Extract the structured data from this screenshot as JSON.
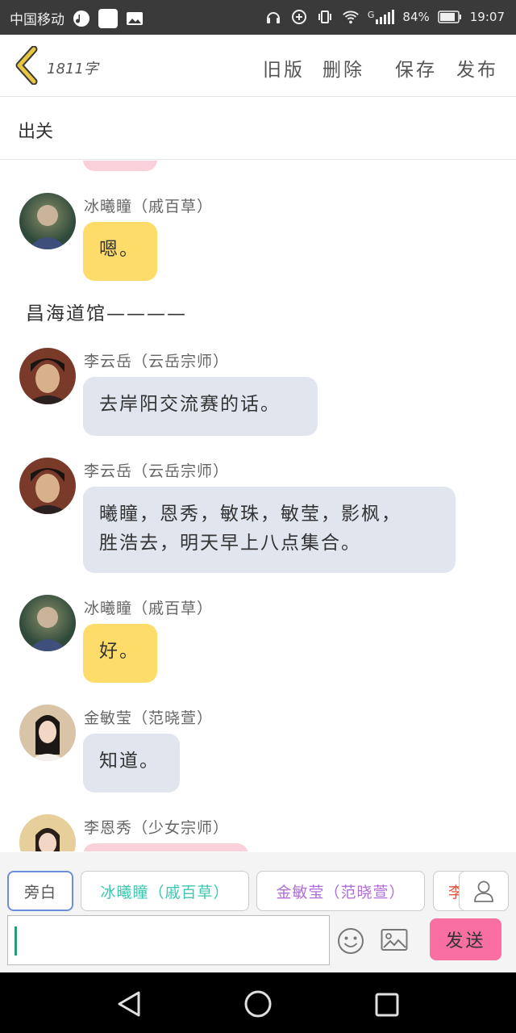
{
  "status": {
    "carrier": "中国移动",
    "signal_label": "G",
    "battery": "84%",
    "time": "19:07"
  },
  "topbar": {
    "word_count": "1811字",
    "old_version": "旧版",
    "delete": "删除",
    "save": "保存",
    "publish": "发布"
  },
  "title": "出关",
  "messages": [
    {
      "name": "冰曦瞳（戚百草）",
      "text": "嗯。",
      "style": "yellow"
    },
    {
      "section": "昌海道馆————"
    },
    {
      "name": "李云岳（云岳宗师）",
      "text": "去岸阳交流赛的话。",
      "style": "blue"
    },
    {
      "name": "李云岳（云岳宗师）",
      "line1": "曦瞳，恩秀，敏珠，敏莹，影枫，",
      "line2": "胜浩去，明天早上八点集合。",
      "style": "blue"
    },
    {
      "name": "冰曦瞳（戚百草）",
      "text": "好。",
      "style": "yellow"
    },
    {
      "name": "金敏莹（范晓萱）",
      "text": "知道。",
      "style": "blue"
    },
    {
      "name": "李恩秀（少女宗师）",
      "text": "",
      "style": "pink"
    }
  ],
  "bottom": {
    "chips": [
      {
        "label": "旁白",
        "color": "#555555"
      },
      {
        "label": "冰曦瞳（戚百草）",
        "color": "#3cc7b0"
      },
      {
        "label": "金敏莹（范晓萱）",
        "color": "#b06fd8"
      },
      {
        "label": "李",
        "color": "#e8553d"
      }
    ],
    "send": "发送"
  },
  "colors": {
    "yellow_bubble": "#fddc6a",
    "blue_bubble": "#e1e6ee",
    "pink_bubble": "#fad0da",
    "send_button": "#f96fa2",
    "back_chevron": "#e8c640"
  }
}
